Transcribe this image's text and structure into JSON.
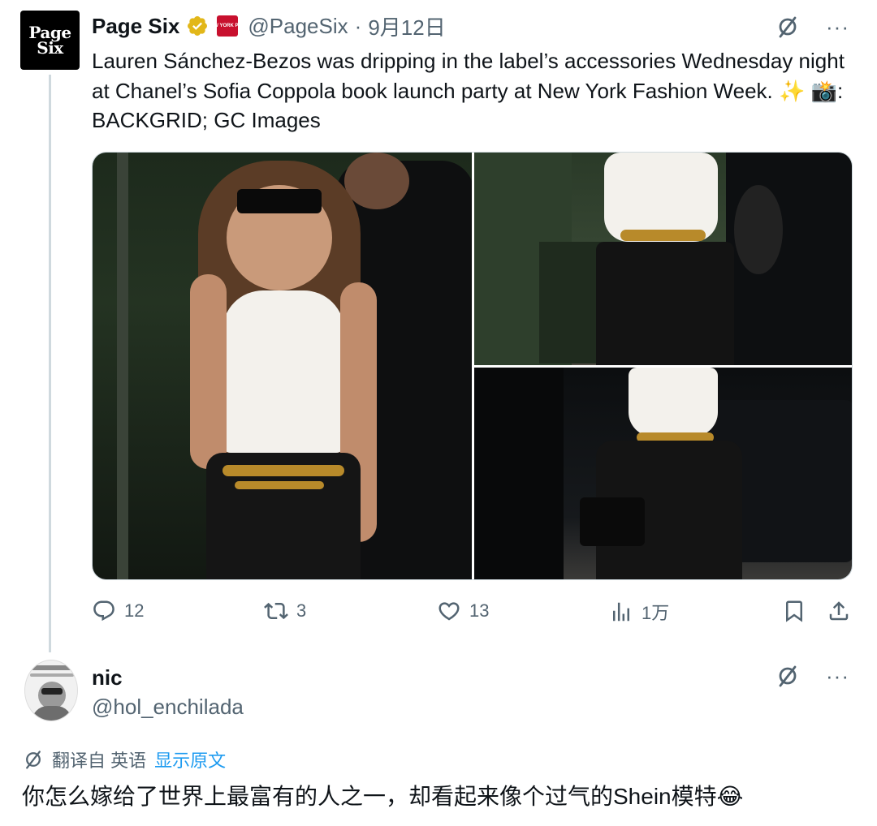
{
  "tweet": {
    "author_name": "Page Six",
    "avatar_text_line1": "Page",
    "avatar_text_line2": "Six",
    "handle": "@PageSix",
    "date": "9月12日",
    "separator": "·",
    "text": "Lauren Sánchez-Bezos was dripping in the label’s accessories Wednesday night at Chanel’s Sofia Coppola book launch party at New York Fashion Week. ✨ 📸: BACKGRID; GC Images",
    "affiliate_badge_text": "NEW YORK POST",
    "more": "···",
    "media": [
      {
        "alt": "photo-1"
      },
      {
        "alt": "photo-2"
      },
      {
        "alt": "photo-3"
      }
    ],
    "stats": {
      "replies": "12",
      "reposts": "3",
      "likes": "13",
      "views": "1万"
    }
  },
  "reply": {
    "author_name": "nic",
    "handle": "@hol_enchilada",
    "more": "···",
    "translate_label": "翻译自 英语",
    "show_original": "显示原文",
    "text": "你怎么嫁给了世界上最富有的人之一，却看起来像个过气的Shein模特😂"
  },
  "colors": {
    "text": "#0f1419",
    "secondary": "#536471",
    "link": "#1d9bf0",
    "verified_gold": "#e2b719",
    "border": "#cfd9de"
  }
}
